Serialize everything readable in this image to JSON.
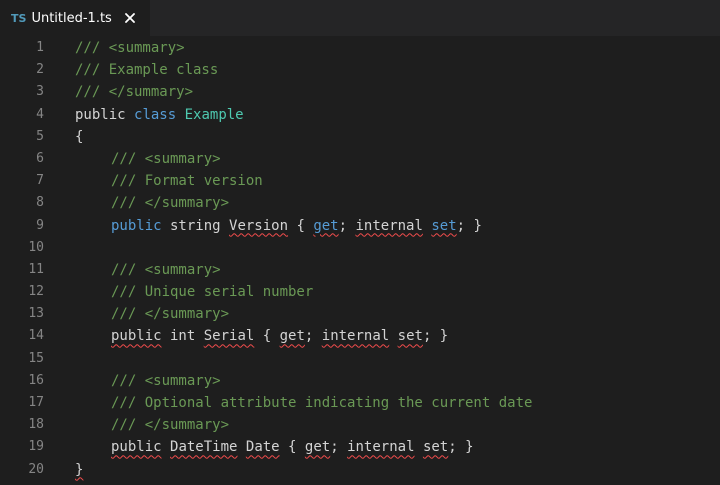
{
  "tab": {
    "language_badge": "TS",
    "title": "Untitled-1.ts",
    "close_icon": "close-icon"
  },
  "colors": {
    "background": "#1e1e1e",
    "tab_bar": "#252526",
    "comment": "#6a9955",
    "keyword": "#569cd6",
    "type": "#4ec9b0",
    "text": "#d4d4d4",
    "line_number": "#858585",
    "error_squiggle": "#f14c4c",
    "ts_badge": "#519aba"
  },
  "current_line": 15,
  "lines": [
    {
      "number": "1",
      "indent": false,
      "tokens": [
        {
          "t": "/// <summary>",
          "c": "comment"
        }
      ]
    },
    {
      "number": "2",
      "indent": false,
      "tokens": [
        {
          "t": "/// Example class",
          "c": "comment"
        }
      ]
    },
    {
      "number": "3",
      "indent": false,
      "tokens": [
        {
          "t": "/// </summary>",
          "c": "comment"
        }
      ]
    },
    {
      "number": "4",
      "indent": false,
      "tokens": [
        {
          "t": "public",
          "c": "plain"
        },
        {
          "t": " ",
          "c": "plain"
        },
        {
          "t": "class",
          "c": "keyword"
        },
        {
          "t": " ",
          "c": "plain"
        },
        {
          "t": "Example",
          "c": "type"
        }
      ]
    },
    {
      "number": "5",
      "indent": false,
      "tokens": [
        {
          "t": "{",
          "c": "plain"
        }
      ]
    },
    {
      "number": "6",
      "indent": true,
      "tokens": [
        {
          "t": "/// <summary>",
          "c": "comment"
        }
      ]
    },
    {
      "number": "7",
      "indent": true,
      "tokens": [
        {
          "t": "/// Format version",
          "c": "comment"
        }
      ]
    },
    {
      "number": "8",
      "indent": true,
      "tokens": [
        {
          "t": "/// </summary>",
          "c": "comment"
        }
      ]
    },
    {
      "number": "9",
      "indent": true,
      "tokens": [
        {
          "t": "public",
          "c": "keyword"
        },
        {
          "t": " string ",
          "c": "plain"
        },
        {
          "t": "Version",
          "c": "plain",
          "err": true
        },
        {
          "t": " { ",
          "c": "plain"
        },
        {
          "t": "get",
          "c": "keyword",
          "err": true
        },
        {
          "t": "; ",
          "c": "plain"
        },
        {
          "t": "internal",
          "c": "plain",
          "err": true
        },
        {
          "t": " ",
          "c": "plain"
        },
        {
          "t": "set",
          "c": "keyword",
          "err": true
        },
        {
          "t": "; }",
          "c": "plain"
        }
      ]
    },
    {
      "number": "10",
      "indent": true,
      "tokens": []
    },
    {
      "number": "11",
      "indent": true,
      "tokens": [
        {
          "t": "/// <summary>",
          "c": "comment"
        }
      ]
    },
    {
      "number": "12",
      "indent": true,
      "tokens": [
        {
          "t": "/// Unique serial number",
          "c": "comment"
        }
      ]
    },
    {
      "number": "13",
      "indent": true,
      "tokens": [
        {
          "t": "/// </summary>",
          "c": "comment"
        }
      ]
    },
    {
      "number": "14",
      "indent": true,
      "tokens": [
        {
          "t": "public",
          "c": "plain",
          "err": true
        },
        {
          "t": " int ",
          "c": "plain"
        },
        {
          "t": "Serial",
          "c": "plain",
          "err": true
        },
        {
          "t": " { ",
          "c": "plain"
        },
        {
          "t": "get",
          "c": "plain",
          "err": true
        },
        {
          "t": "; ",
          "c": "plain"
        },
        {
          "t": "internal",
          "c": "plain",
          "err": true
        },
        {
          "t": " ",
          "c": "plain"
        },
        {
          "t": "set",
          "c": "plain",
          "err": true
        },
        {
          "t": "; }",
          "c": "plain"
        }
      ]
    },
    {
      "number": "15",
      "indent": false,
      "tokens": []
    },
    {
      "number": "16",
      "indent": true,
      "tokens": [
        {
          "t": "/// <summary>",
          "c": "comment"
        }
      ]
    },
    {
      "number": "17",
      "indent": true,
      "tokens": [
        {
          "t": "/// Optional attribute indicating the current date",
          "c": "comment"
        }
      ]
    },
    {
      "number": "18",
      "indent": true,
      "tokens": [
        {
          "t": "/// </summary>",
          "c": "comment"
        }
      ]
    },
    {
      "number": "19",
      "indent": true,
      "tokens": [
        {
          "t": "public",
          "c": "plain",
          "err": true
        },
        {
          "t": " ",
          "c": "plain"
        },
        {
          "t": "DateTime",
          "c": "plain",
          "err": true
        },
        {
          "t": " ",
          "c": "plain"
        },
        {
          "t": "Date",
          "c": "plain",
          "err": true
        },
        {
          "t": " { ",
          "c": "plain"
        },
        {
          "t": "get",
          "c": "plain",
          "err": true
        },
        {
          "t": "; ",
          "c": "plain"
        },
        {
          "t": "internal",
          "c": "plain",
          "err": true
        },
        {
          "t": " ",
          "c": "plain"
        },
        {
          "t": "set",
          "c": "plain",
          "err": true
        },
        {
          "t": "; }",
          "c": "plain"
        }
      ]
    },
    {
      "number": "20",
      "indent": false,
      "tokens": [
        {
          "t": "}",
          "c": "plain",
          "err": true
        }
      ]
    }
  ]
}
